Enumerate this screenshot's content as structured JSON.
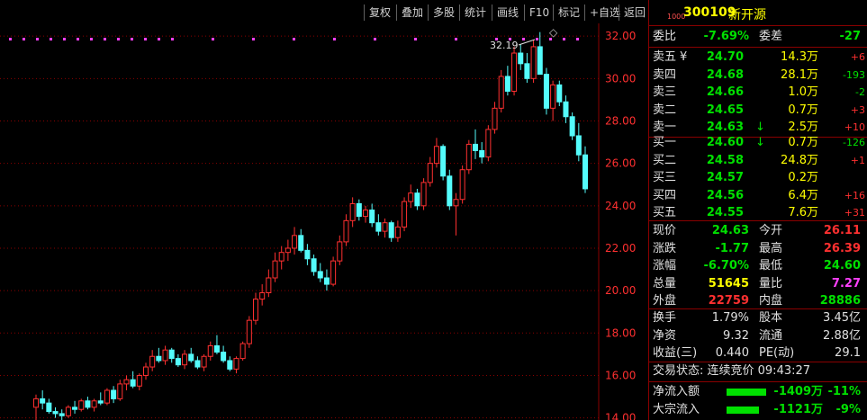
{
  "toolbar": {
    "buttons": [
      "复权",
      "叠加",
      "多股",
      "统计",
      "画线",
      "F10",
      "标记",
      "+自选",
      "返回"
    ]
  },
  "chart": {
    "y_axis_ticks": [
      "32.00",
      "30.00",
      "28.00",
      "26.00",
      "24.00",
      "22.00",
      "20.00",
      "18.00",
      "16.00",
      "14.00"
    ],
    "high_annotation": "32.19",
    "diamond_icon": "◇",
    "colors": {
      "up": "#ff3030",
      "down": "#54fcfc",
      "grid": "#8a0000",
      "axis_text": "#ff3030",
      "marker": "#ff40ff"
    }
  },
  "chart_data": {
    "type": "candlestick",
    "ylim": [
      13.9,
      32.6
    ],
    "y_ticks": [
      32,
      30,
      28,
      26,
      24,
      22,
      20,
      18,
      16,
      14
    ],
    "high_label": "32.19",
    "candles": [
      [
        14.5,
        15.1,
        13.9,
        14.9
      ],
      [
        14.9,
        15.3,
        14.4,
        14.7
      ],
      [
        14.7,
        14.9,
        14.2,
        14.3
      ],
      [
        14.3,
        14.5,
        14.0,
        14.2
      ],
      [
        14.2,
        14.4,
        13.9,
        14.1
      ],
      [
        14.1,
        14.6,
        14.0,
        14.5
      ],
      [
        14.5,
        14.8,
        14.2,
        14.4
      ],
      [
        14.4,
        14.9,
        14.3,
        14.8
      ],
      [
        14.8,
        15.0,
        14.4,
        14.5
      ],
      [
        14.5,
        14.9,
        14.3,
        14.8
      ],
      [
        14.8,
        15.2,
        14.6,
        14.7
      ],
      [
        14.7,
        15.4,
        14.6,
        15.3
      ],
      [
        15.3,
        15.5,
        14.7,
        14.9
      ],
      [
        14.9,
        15.8,
        14.8,
        15.6
      ],
      [
        15.6,
        16.0,
        15.3,
        15.8
      ],
      [
        15.8,
        16.2,
        15.4,
        15.5
      ],
      [
        15.5,
        16.1,
        15.3,
        16.0
      ],
      [
        16.0,
        16.6,
        15.8,
        16.4
      ],
      [
        16.4,
        17.2,
        16.2,
        16.9
      ],
      [
        16.9,
        17.3,
        16.6,
        16.7
      ],
      [
        16.7,
        17.4,
        16.5,
        17.2
      ],
      [
        17.2,
        17.3,
        16.6,
        16.8
      ],
      [
        16.8,
        17.0,
        16.4,
        16.5
      ],
      [
        16.5,
        17.2,
        16.3,
        17.0
      ],
      [
        17.0,
        17.3,
        16.6,
        16.7
      ],
      [
        16.7,
        16.9,
        16.3,
        16.4
      ],
      [
        16.4,
        17.0,
        16.2,
        16.9
      ],
      [
        16.9,
        17.6,
        16.7,
        17.4
      ],
      [
        17.4,
        17.9,
        17.0,
        17.1
      ],
      [
        17.1,
        17.4,
        16.6,
        16.7
      ],
      [
        16.7,
        16.9,
        16.2,
        16.3
      ],
      [
        16.3,
        16.9,
        16.1,
        16.8
      ],
      [
        16.8,
        17.6,
        16.7,
        17.5
      ],
      [
        17.5,
        18.8,
        17.3,
        18.6
      ],
      [
        18.6,
        19.9,
        18.4,
        19.6
      ],
      [
        19.6,
        20.3,
        19.3,
        19.9
      ],
      [
        19.9,
        21.0,
        19.7,
        20.6
      ],
      [
        20.6,
        21.8,
        20.4,
        21.4
      ],
      [
        21.4,
        22.1,
        21.0,
        21.8
      ],
      [
        21.8,
        22.4,
        21.4,
        22.0
      ],
      [
        22.0,
        23.0,
        21.7,
        22.6
      ],
      [
        22.6,
        22.9,
        21.8,
        21.9
      ],
      [
        21.9,
        22.2,
        21.2,
        21.5
      ],
      [
        21.5,
        21.7,
        20.7,
        20.9
      ],
      [
        20.9,
        21.3,
        20.4,
        20.6
      ],
      [
        20.6,
        21.0,
        20.0,
        20.3
      ],
      [
        20.3,
        21.6,
        20.2,
        21.4
      ],
      [
        21.4,
        22.6,
        21.2,
        22.3
      ],
      [
        22.3,
        23.6,
        22.1,
        23.3
      ],
      [
        23.3,
        24.4,
        23.0,
        24.1
      ],
      [
        24.1,
        24.3,
        23.3,
        23.5
      ],
      [
        23.5,
        24.0,
        23.2,
        23.8
      ],
      [
        23.8,
        24.1,
        23.0,
        23.2
      ],
      [
        23.2,
        23.6,
        22.6,
        22.8
      ],
      [
        22.8,
        23.4,
        22.5,
        23.2
      ],
      [
        23.2,
        23.3,
        22.3,
        22.5
      ],
      [
        22.5,
        23.3,
        22.3,
        23.0
      ],
      [
        23.0,
        24.4,
        22.8,
        24.2
      ],
      [
        24.2,
        25.0,
        23.9,
        24.6
      ],
      [
        24.6,
        24.8,
        23.8,
        24.0
      ],
      [
        24.0,
        25.3,
        23.8,
        25.1
      ],
      [
        25.1,
        26.3,
        24.9,
        26.0
      ],
      [
        26.0,
        27.2,
        25.8,
        26.8
      ],
      [
        26.8,
        26.9,
        25.2,
        25.4
      ],
      [
        25.4,
        25.7,
        23.8,
        24.0
      ],
      [
        24.0,
        24.6,
        22.6,
        24.3
      ],
      [
        24.3,
        25.9,
        24.1,
        25.7
      ],
      [
        25.7,
        27.1,
        25.5,
        26.9
      ],
      [
        26.9,
        27.6,
        26.2,
        26.6
      ],
      [
        26.6,
        27.0,
        26.0,
        26.3
      ],
      [
        26.3,
        27.8,
        26.1,
        27.6
      ],
      [
        27.6,
        28.9,
        27.4,
        28.6
      ],
      [
        28.6,
        30.4,
        28.4,
        30.1
      ],
      [
        30.1,
        30.6,
        29.2,
        29.4
      ],
      [
        29.4,
        31.5,
        29.2,
        31.2
      ],
      [
        31.2,
        31.6,
        30.4,
        30.7
      ],
      [
        30.7,
        31.2,
        29.8,
        30.0
      ],
      [
        30.0,
        31.8,
        29.8,
        31.5
      ],
      [
        31.5,
        32.19,
        31.0,
        30.2
      ],
      [
        30.2,
        30.5,
        28.3,
        28.6
      ],
      [
        28.6,
        29.9,
        28.0,
        29.7
      ],
      [
        29.7,
        29.9,
        28.7,
        28.9
      ],
      [
        28.9,
        29.2,
        27.9,
        28.2
      ],
      [
        28.2,
        28.4,
        27.1,
        27.3
      ],
      [
        27.3,
        27.9,
        26.1,
        26.4
      ],
      [
        26.4,
        26.8,
        24.6,
        24.8
      ]
    ]
  },
  "panel": {
    "small_tag": "1000",
    "code": "300109",
    "name": "新开源",
    "weibi": {
      "label": "委比",
      "value": "-7.69%",
      "label2": "委差",
      "value2": "-27"
    },
    "yen_icon": "¥",
    "arrow_icon": "↓",
    "asks": [
      {
        "label": "卖五",
        "price": "24.70",
        "vol": "14.3万",
        "chg": "+6"
      },
      {
        "label": "卖四",
        "price": "24.68",
        "vol": "28.1万",
        "chg": "-193"
      },
      {
        "label": "卖三",
        "price": "24.66",
        "vol": "1.0万",
        "chg": "-2"
      },
      {
        "label": "卖二",
        "price": "24.65",
        "vol": "0.7万",
        "chg": "+3"
      },
      {
        "label": "卖一",
        "price": "24.63",
        "vol": "2.5万",
        "chg": "+10"
      }
    ],
    "bids": [
      {
        "label": "买一",
        "price": "24.60",
        "vol": "0.7万",
        "chg": "-126"
      },
      {
        "label": "买二",
        "price": "24.58",
        "vol": "24.8万",
        "chg": "+1"
      },
      {
        "label": "买三",
        "price": "24.57",
        "vol": "0.2万",
        "chg": ""
      },
      {
        "label": "买四",
        "price": "24.56",
        "vol": "6.4万",
        "chg": "+16"
      },
      {
        "label": "买五",
        "price": "24.55",
        "vol": "7.6万",
        "chg": "+31"
      }
    ],
    "quote": [
      {
        "l1": "现价",
        "v1": "24.63",
        "l2": "今开",
        "v2": "26.11"
      },
      {
        "l1": "涨跌",
        "v1": "-1.77",
        "l2": "最高",
        "v2": "26.39"
      },
      {
        "l1": "涨幅",
        "v1": "-6.70%",
        "l2": "最低",
        "v2": "24.60"
      },
      {
        "l1": "总量",
        "v1": "51645",
        "l2": "量比",
        "v2": "7.27"
      },
      {
        "l1": "外盘",
        "v1": "22759",
        "l2": "内盘",
        "v2": "28886"
      }
    ],
    "fund": [
      {
        "l1": "换手",
        "v1": "1.79%",
        "l2": "股本",
        "v2": "3.45亿"
      },
      {
        "l1": "净资",
        "v1": "9.32",
        "l2": "流通",
        "v2": "2.88亿"
      },
      {
        "l1": "收益(三)",
        "v1": "0.440",
        "l2": "PE(动)",
        "v2": "29.1"
      }
    ],
    "trade_state": "交易状态: 连续竞价 09:43:27",
    "flows": [
      {
        "label": "净流入额",
        "value": "-1409万",
        "pct": "-11%",
        "bar_pct": 0.11
      },
      {
        "label": "大宗流入",
        "value": "-1121万",
        "pct": "-9%",
        "bar_pct": 0.09
      }
    ]
  }
}
